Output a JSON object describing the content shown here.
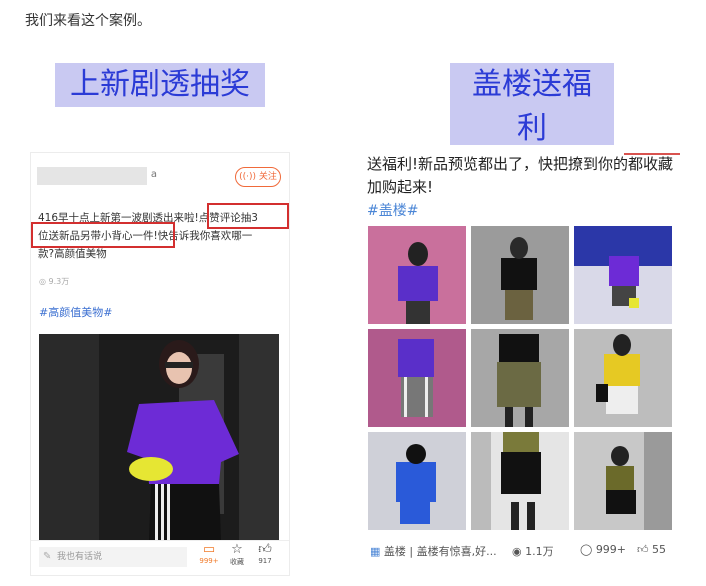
{
  "intro_text": "我们来看这个案例。",
  "labels": {
    "left": "上新剧透抽奖",
    "right": "盖楼送福利"
  },
  "left_post": {
    "user_suffix": "a",
    "follow": "关注",
    "line1": "416早十点上新第一波剧透出来啦!点赞评论抽3",
    "line2": "位送新品另带小背心一件!快告诉我你喜欢哪一",
    "line3": "款?高颜值美物",
    "views": "9.3万",
    "hashtag": "#高颜值美物#",
    "comment_placeholder": "我也有话说",
    "comments_count": "999+",
    "fav_label": "收藏",
    "likes_count": "917"
  },
  "right_post": {
    "text": "送福利!新品预览都出了，快把撩到你的都收藏加购起来!",
    "hashtag": "#盖楼#",
    "topic": "盖楼 | 盖楼有惊喜,好...",
    "views": "1.1万",
    "comments": "999+",
    "likes": "55"
  },
  "colors": {
    "accent_blue": "#2b3bd6",
    "label_bg": "#c9c9f2",
    "highlight_red": "#d32f2f",
    "link_blue": "#3b6fd1"
  }
}
